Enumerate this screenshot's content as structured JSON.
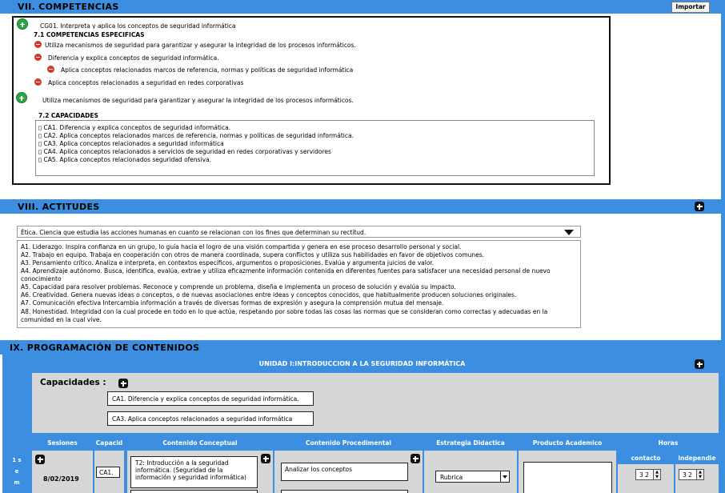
{
  "sec7": {
    "title": "VII. COMPETENCIAS",
    "import_label": "Importar",
    "general": "CG01. Interpreta y aplica los conceptos de seguridad informática",
    "specific_title": "7.1 COMPETENCIAS ESPECIFICAS",
    "items": [
      "Utiliza mecanismos de seguridad para garantizar y asegurar la integridad de los procesos informáticos.",
      "Diferencia y explica conceptos de seguridad informática.",
      "Aplica conceptos relacionados marcos de referencia, normas y políticas de seguridad informática",
      "Aplica conceptos relacionados a seguridad en redes corporativas"
    ],
    "item5": "Utiliza mecanismos de seguridad para garantizar y asegurar la integridad de los procesos informáticos.",
    "cap_title": "7.2 CAPACIDADES",
    "capacities": [
      "▯ CA1. Diferencia y explica conceptos de seguridad informática.",
      "▯ CA2. Aplica conceptos relacionados marcos de referencia, normas y políticas de seguridad informática.",
      "▯ CA3. Aplica conceptos relacionados a seguridad informática",
      "▯ CA4. Aplica conceptos relacionados a servicios de seguridad en redes corporativas y servidores",
      "▯ CA5. Aplica conceptos relacionados seguridad ofensiva."
    ]
  },
  "sec8": {
    "title": "VIII. ACTITUDES",
    "select_value": "Ética. Ciencia que estudia las acciones humanas en cuanto se relacionan con los fines que determinan su rectitud.",
    "attitudes": [
      "A1. Liderazgo. Inspira confianza en un grupo, lo guía hacia el logro de una visión compartida y genera en ese proceso desarrollo personal y social.",
      "A2. Trabajo en equipo. Trabaja en cooperación con otros de manera coordinada, supera conflictos y utiliza sus habilidades en favor de objetivos comunes.",
      "A3. Pensamiento crítico. Analiza e interpreta, en contextos específicos, argumentos o proposiciones. Evalúa y argumenta juicios de valor.",
      "A4. Aprendizaje autónomo. Busca, identifica, evalúa, extrae y utiliza eficazmente información contenida en diferentes fuentes para satisfacer una necesidad personal de nuevo",
      "conocimiento",
      "A5. Capacidad para resolver problemas. Reconoce y comprende un problema, diseña e implementa un proceso de solución y evalúa su impacto.",
      "A6. Creatividad. Genera nuevas ideas o conceptos, o de nuevas asociaciones entre ideas y conceptos conocidos, que habitualmente producen soluciones originales.",
      "A7. Comunicación efectiva Intercambia información a través de diversas formas de expresión y asegura la comprensión mutua del mensaje.",
      "A8. Honestidad. Integridad con la cual procede en todo en lo que actúa, respetando por sobre todas las cosas las normas que se consideran como correctas y adecuadas en la",
      "comunidad en la cual vive."
    ]
  },
  "sec9": {
    "title": "IX. PROGRAMACIÓN DE CONTENIDOS",
    "unit_title": "UNIDAD I:INTRODUCCION A LA SEGURIDAD INFORMÁTICA",
    "cap_label": "Capacidades :",
    "caps": [
      "CA1. Diferencia y explica conceptos de seguridad informática.",
      "CA3. Aplica conceptos relacionados a seguridad informática"
    ],
    "side_label": "1 s e m",
    "headers": {
      "sesiones": "Sesiones",
      "capacid": "Capacid",
      "conceptual": "Contenido Conceptual",
      "procedimental": "Contenido Procedimental",
      "estrategia": "Estrategia Didactica",
      "producto": "Producto Academico",
      "horas": "Horas",
      "contacto": "contacto",
      "independiente": "independie"
    },
    "row": {
      "date": "8/02/2019",
      "cap": "CA1.",
      "conceptual": "T2: Introducción a la seguridad informática. (Seguridad de la información y seguridad informática)",
      "procedimental": "Analizar los conceptos",
      "estrategia": "Rubrica",
      "contacto": "3 2",
      "independiente": "3 2"
    }
  }
}
